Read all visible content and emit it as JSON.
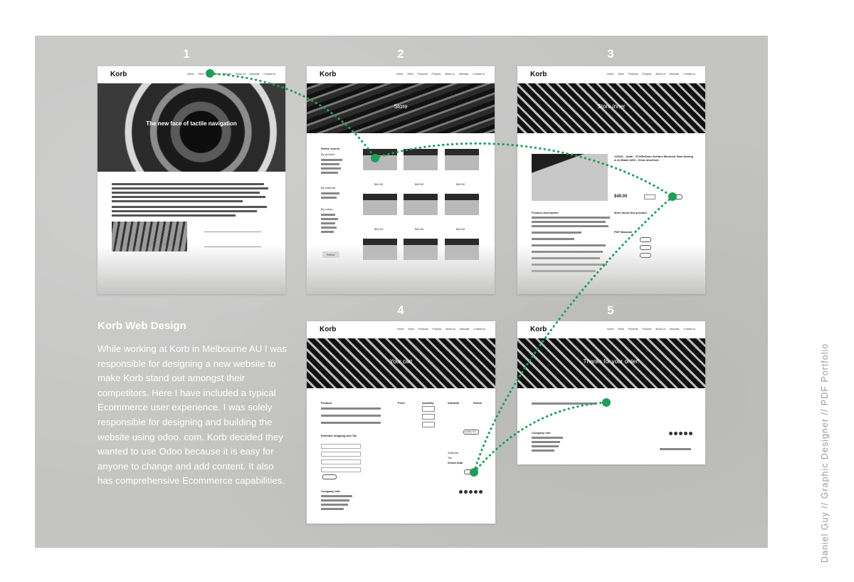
{
  "steps": [
    "1",
    "2",
    "3",
    "4",
    "5"
  ],
  "brand": "Korb",
  "nav": {
    "home_page": [
      "Home",
      "Store",
      "Products",
      "Projects",
      "About us",
      "Manuals",
      "Contact us"
    ],
    "other_pages": [
      "Home",
      "Store",
      "Products",
      "Projects",
      "About us",
      "Manuals",
      "Contact us"
    ]
  },
  "screens": {
    "home": {
      "hero_title": "The new face of tactile navigation"
    },
    "store": {
      "hero_title": "Store",
      "refine_label": "Refine search",
      "filter_groups": [
        "By product",
        "By material",
        "By colour"
      ],
      "refine_button": "Refine",
      "price": "$49.00"
    },
    "store_inner": {
      "hero_title": "Store inner",
      "product_title": "126311 - Aaltn - 57x65x5mm Surface Mounted Stair Nosing w 4x Black Infill - Clear Anodised",
      "price": "$49.00",
      "description_heading": "Product description",
      "more_heading": "More about this product",
      "manuals_heading": "PDF Manuals"
    },
    "cart": {
      "hero_title": "Your cart",
      "cols": [
        "Product",
        "Price",
        "Quantity",
        "Subtotal",
        "Delete"
      ],
      "shipping_heading": "Estimate shipping and Tax",
      "update_button": "Update cart",
      "totals": [
        "Subtotal",
        "Tax",
        "Grand total"
      ],
      "company_heading": "Company info"
    },
    "thanks": {
      "hero_title": "Thanks for your order!",
      "company_heading": "Company info"
    }
  },
  "caption": {
    "title": "Korb Web Design",
    "body": "While working at Korb in Melbourne AU I was responsible for designing a new website to make Korb stand out amongst their competitors. Here I have included a typical Ecommerce user experience. I was solely responsible for designing and building the website using odoo. com. Korb decided they wanted to use Odoo because it is easy for anyone to change and add content. It also has comprehensive Ecommerce capabilities."
  },
  "side_label": "Daniel Guy // Graphic Designer // PDF Portfolio",
  "colors": {
    "flow": "#1f9e5a",
    "board": "#c4c5c3"
  }
}
